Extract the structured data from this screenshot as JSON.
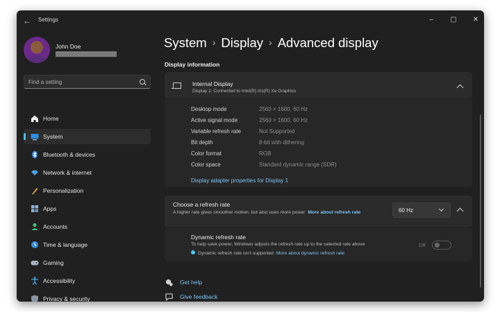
{
  "window": {
    "title": "Settings",
    "minimize": "–",
    "maximize": "▢",
    "close": "✕",
    "back": "←"
  },
  "user": {
    "name": "John Doe"
  },
  "search": {
    "placeholder": "Find a setting"
  },
  "sidebar": {
    "items": [
      {
        "label": "Home",
        "icon": "home-icon",
        "active": false
      },
      {
        "label": "System",
        "icon": "system-icon",
        "active": true
      },
      {
        "label": "Bluetooth & devices",
        "icon": "bluetooth-icon",
        "active": false
      },
      {
        "label": "Network & internet",
        "icon": "network-icon",
        "active": false
      },
      {
        "label": "Personalization",
        "icon": "personalization-icon",
        "active": false
      },
      {
        "label": "Apps",
        "icon": "apps-icon",
        "active": false
      },
      {
        "label": "Accounts",
        "icon": "accounts-icon",
        "active": false
      },
      {
        "label": "Time & language",
        "icon": "time-language-icon",
        "active": false
      },
      {
        "label": "Gaming",
        "icon": "gaming-icon",
        "active": false
      },
      {
        "label": "Accessibility",
        "icon": "accessibility-icon",
        "active": false
      },
      {
        "label": "Privacy & security",
        "icon": "privacy-icon",
        "active": false
      }
    ]
  },
  "breadcrumb": {
    "part1": "System",
    "part2": "Display",
    "part3": "Advanced display",
    "sep": "›"
  },
  "section": {
    "title": "Display information"
  },
  "display": {
    "title": "Internal Display",
    "subtitle": "Display 1: Connected to Intel(R) Iris(R) Xe Graphics",
    "rows": [
      {
        "key": "Desktop mode",
        "value": "2560 × 1600, 60 Hz"
      },
      {
        "key": "Active signal mode",
        "value": "2560 × 1600, 60 Hz"
      },
      {
        "key": "Variable refresh rate",
        "value": "Not Supported"
      },
      {
        "key": "Bit depth",
        "value": "8-bit with dithering"
      },
      {
        "key": "Color format",
        "value": "RGB"
      },
      {
        "key": "Color space",
        "value": "Standard dynamic range (SDR)"
      }
    ],
    "adapter_link": "Display adapter properties for Display 1"
  },
  "refresh": {
    "title": "Choose a refresh rate",
    "desc": "A higher rate gives smoother motion, but also uses more power",
    "link": "More about refresh rate",
    "value": "60 Hz"
  },
  "dynamic": {
    "title": "Dynamic refresh rate",
    "desc": "To help save power, Windows adjusts the refresh rate up to the selected rate above",
    "note": "Dynamic refresh rate isn't supported",
    "note_link": "More about dynamic refresh rate",
    "state": "Off"
  },
  "help": {
    "get_help": "Get help",
    "feedback": "Give feedback"
  },
  "colors": {
    "accent": "#4cc2ff",
    "link": "#7cc4f2",
    "bg": "#202020",
    "card": "#2b2b2b"
  }
}
